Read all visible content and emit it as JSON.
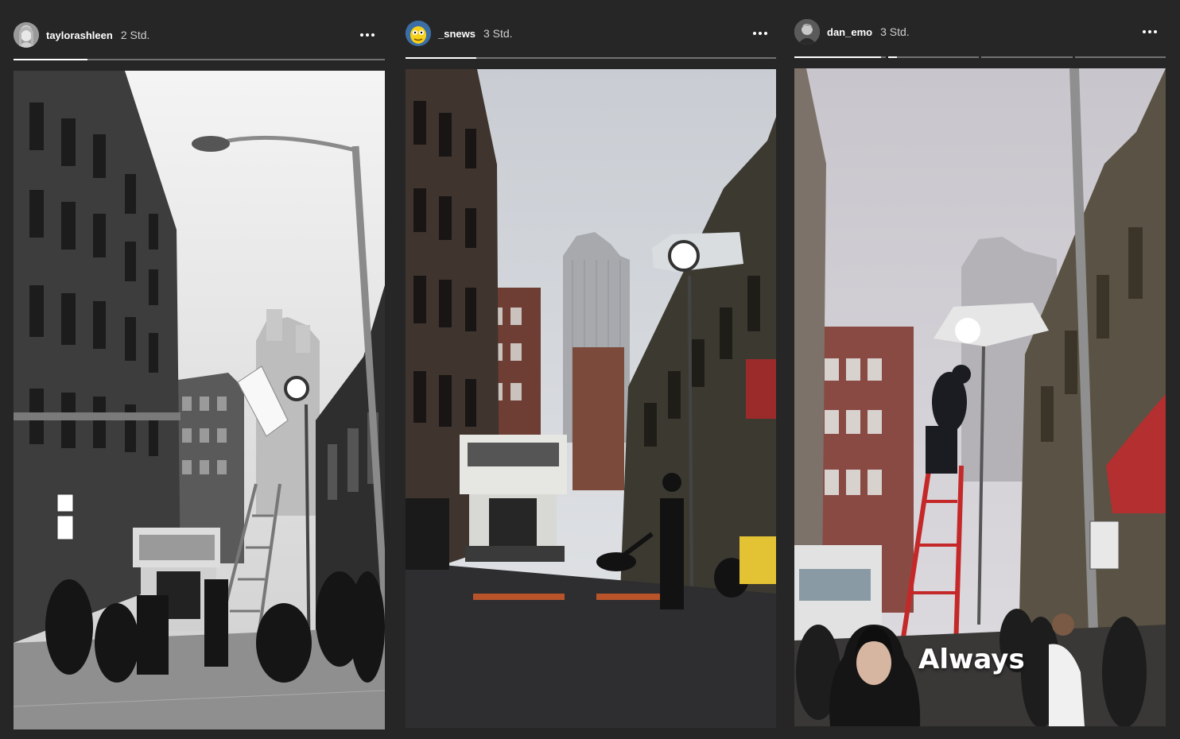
{
  "stories": [
    {
      "username": "taylorashleen",
      "time": "2 Std.",
      "progress": [
        0.2
      ],
      "style": "black-and-white street photo with film light and ladder"
    },
    {
      "username": "_snews",
      "time": "3 Std.",
      "progress": [
        0.19
      ],
      "style": "color street photo with truck and film light"
    },
    {
      "username": "dan_emo",
      "time": "3 Std.",
      "progress": [
        0.95,
        0.1,
        0,
        0
      ],
      "caption": "Always",
      "style": "video frame with man on red ladder and sticker"
    }
  ],
  "icons": {
    "more": "more-options-icon",
    "avatar": "avatar"
  },
  "colors": {
    "background": "#262626",
    "text": "#ffffff",
    "time": "#cfcfcf"
  }
}
